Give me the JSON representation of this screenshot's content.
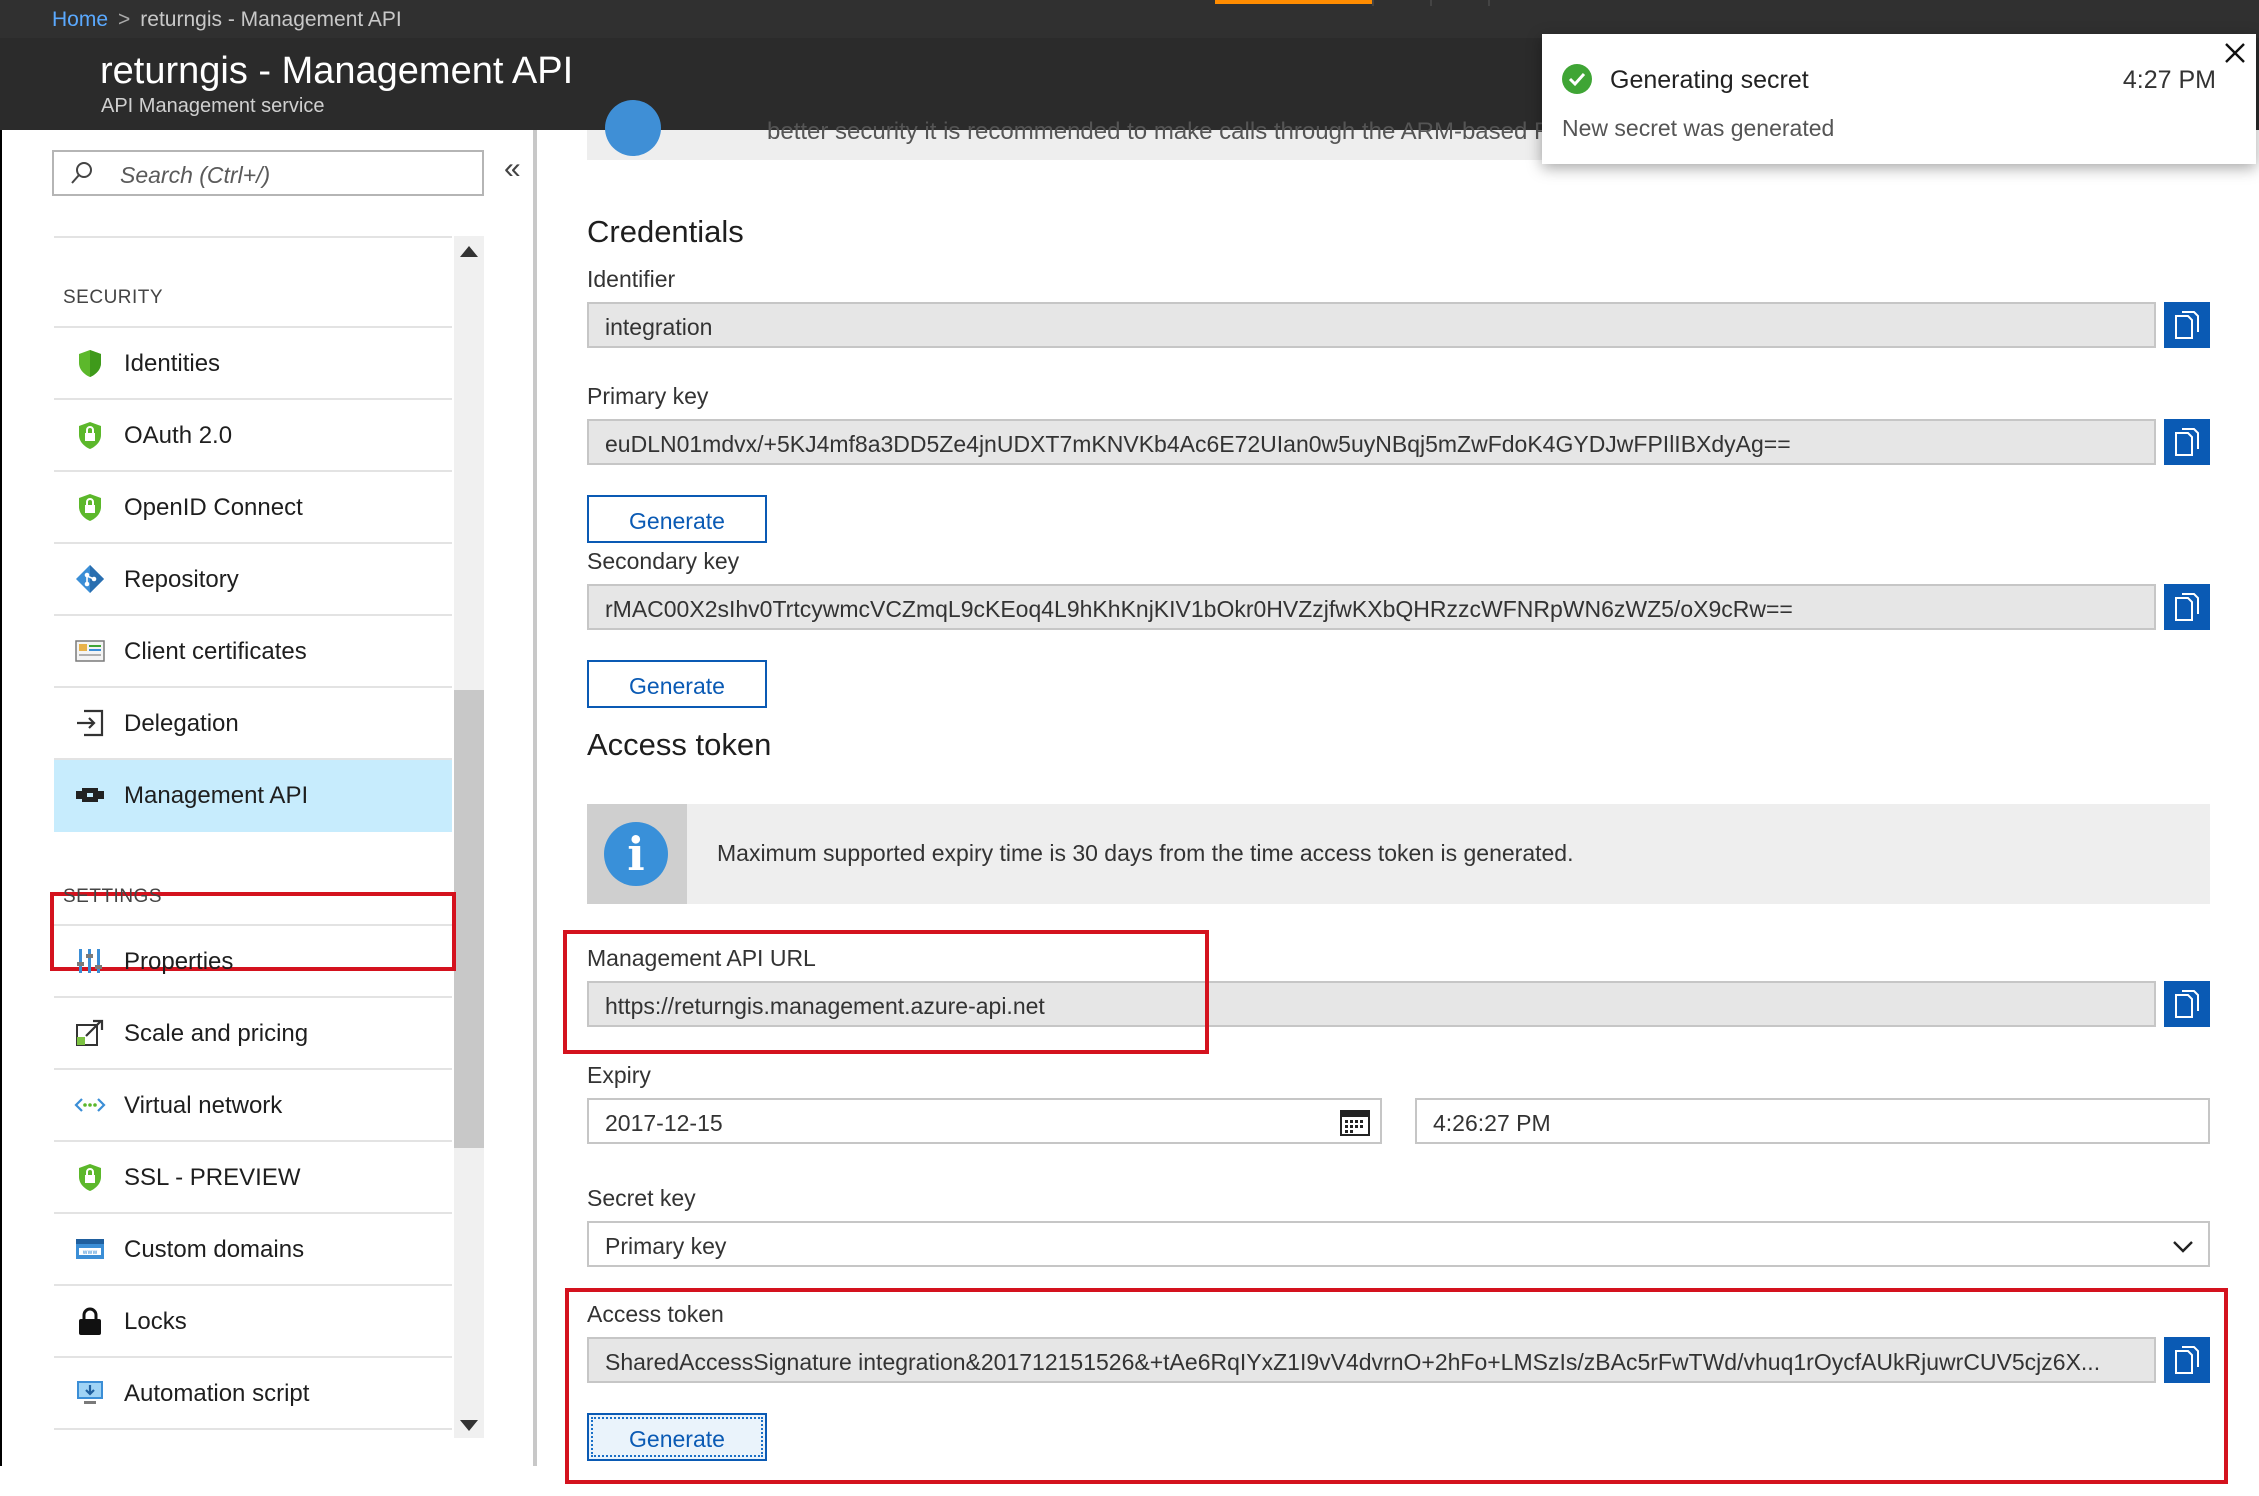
{
  "breadcrumb": {
    "home": "Home",
    "separator": ">",
    "current": "returngis - Management API"
  },
  "blade": {
    "title": "returngis - Management API",
    "subtitle": "API Management service"
  },
  "sidebar": {
    "search_placeholder": "Search (Ctrl+/)",
    "collapse_glyph": "«",
    "security_header": "SECURITY",
    "settings_header": "SETTINGS",
    "security_items": [
      {
        "label": "Identities",
        "icon": "shield-icon"
      },
      {
        "label": "OAuth 2.0",
        "icon": "shield-lock-icon"
      },
      {
        "label": "OpenID Connect",
        "icon": "shield-lock-icon"
      },
      {
        "label": "Repository",
        "icon": "git-diamond-icon"
      },
      {
        "label": "Client certificates",
        "icon": "certificate-icon"
      },
      {
        "label": "Delegation",
        "icon": "delegation-icon"
      },
      {
        "label": "Management API",
        "icon": "api-plug-icon",
        "selected": true
      }
    ],
    "settings_items": [
      {
        "label": "Properties",
        "icon": "properties-icon"
      },
      {
        "label": "Scale and pricing",
        "icon": "scale-icon"
      },
      {
        "label": "Virtual network",
        "icon": "vnet-icon"
      },
      {
        "label": "SSL - PREVIEW",
        "icon": "shield-lock-icon"
      },
      {
        "label": "Custom domains",
        "icon": "www-icon"
      },
      {
        "label": "Locks",
        "icon": "lock-icon"
      },
      {
        "label": "Automation script",
        "icon": "automation-icon"
      }
    ]
  },
  "banner_text": "better security it is recommended to make calls through the ARM-based REST",
  "credentials": {
    "heading": "Credentials",
    "identifier_label": "Identifier",
    "identifier_value": "integration",
    "primary_label": "Primary key",
    "primary_value": "euDLN01mdvx/+5KJ4mf8a3DD5Ze4jnUDXT7mKNVKb4Ac6E72UIan0w5uyNBqj5mZwFdoK4GYDJwFPIlIBXdyAg==",
    "secondary_label": "Secondary key",
    "secondary_value": "rMAC00X2sIhv0TrtcywmcVCZmqL9cKEoq4L9hKhKnjKIV1bOkr0HVZzjfwKXbQHRzzcWFNRpWN6zWZ5/oX9cRw==",
    "generate_label": "Generate"
  },
  "access_token": {
    "heading": "Access token",
    "info_text": "Maximum supported expiry time is 30 days from the time access token is generated.",
    "url_label": "Management API URL",
    "url_value": "https://returngis.management.azure-api.net",
    "expiry_label": "Expiry",
    "expiry_date": "2017-12-15",
    "expiry_time": "4:26:27 PM",
    "secret_key_label": "Secret key",
    "secret_key_value": "Primary key",
    "token_label": "Access token",
    "token_value": "SharedAccessSignature integration&201712151526&+tAe6RqIYxZ1I9vV4dvrnO+2hFo+LMSzIs/zBAc5rFwTWd/vhuq1rOycfAUkRjuwrCUV5cjz6X...",
    "generate_label": "Generate"
  },
  "toast": {
    "title": "Generating secret",
    "time": "4:27 PM",
    "message": "New secret was generated"
  },
  "colors": {
    "accent": "#0a5ab4",
    "highlight_border": "#d4121e",
    "selected_bg": "#c7ecfd",
    "success": "#3fa535",
    "topbar": "#2b2b2b"
  }
}
